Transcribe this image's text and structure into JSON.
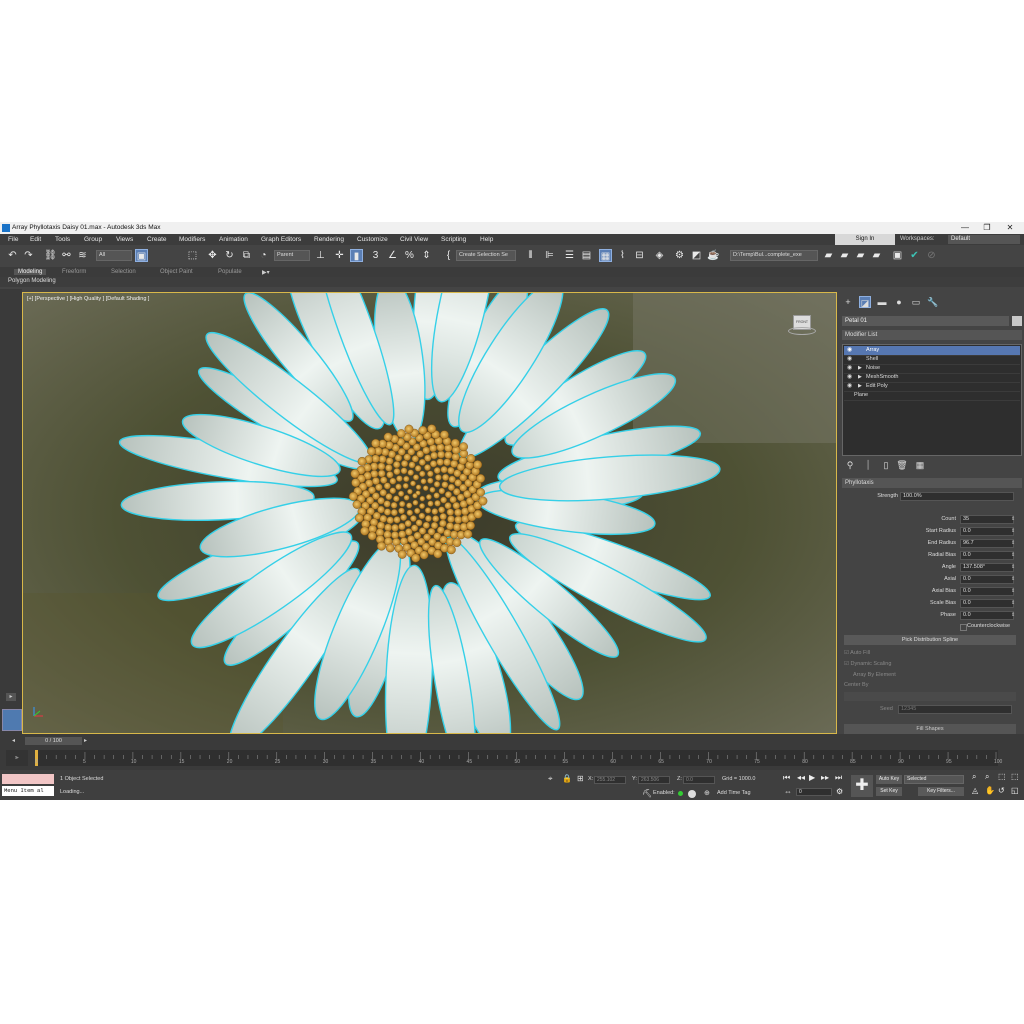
{
  "window": {
    "title": "Array Phyllotaxis Daisy 01.max - Autodesk 3ds Max",
    "minimize": "—",
    "maximize": "❐",
    "close": "✕"
  },
  "menu": [
    "File",
    "Edit",
    "Tools",
    "Group",
    "Views",
    "Create",
    "Modifiers",
    "Animation",
    "Graph Editors",
    "Rendering",
    "Customize",
    "Civil View",
    "Scripting",
    "Help"
  ],
  "account": {
    "sign_in": "Sign In",
    "workspaces_label": "Workspaces:",
    "workspace": "Default"
  },
  "toolbar": {
    "filter": "All",
    "coord_system": "Parent",
    "selection_set": "Create Selection Se",
    "project_path": "D:\\Temp\\Bul...complete_exe"
  },
  "ribbon": {
    "tabs": [
      "Modeling",
      "Freeform",
      "Selection",
      "Object Paint",
      "Populate"
    ],
    "panel": "Polygon Modeling"
  },
  "viewport": {
    "label": "[+] [Perspective ] [High Quality ] [Default Shading ]",
    "viewcube": "FRONT"
  },
  "command_panel": {
    "object_name": "Petal 01",
    "modifier_list": "Modifier List",
    "stack": [
      {
        "name": "Array",
        "selected": true
      },
      {
        "name": "Shell"
      },
      {
        "name": "Noise"
      },
      {
        "name": "MeshSmooth"
      },
      {
        "name": "Edit Poly"
      },
      {
        "name": "Plane"
      }
    ],
    "rollout": "Phyllotaxis",
    "strength_label": "Strength",
    "strength": "100.0%",
    "params": [
      {
        "label": "Count",
        "value": "35"
      },
      {
        "label": "Start Radius",
        "value": "0.0"
      },
      {
        "label": "End Radius",
        "value": "96.7"
      },
      {
        "label": "Radial Bias",
        "value": "0.0"
      },
      {
        "label": "Angle",
        "value": "137.508°"
      },
      {
        "label": "Axial",
        "value": "0.0"
      },
      {
        "label": "Axial Bias",
        "value": "0.0"
      },
      {
        "label": "Scale Bias",
        "value": "0.0"
      },
      {
        "label": "Phase",
        "value": "0.0"
      }
    ],
    "counterclockwise": "Counterclockwise",
    "pick_spline": "Pick Distribution Spline",
    "auto_fill": "Auto Fill",
    "dynamic_scaling": "Dynamic Scaling",
    "array_by_element": "Array By Element",
    "center_by": "Center By",
    "seed_label": "Seed",
    "seed": "12345",
    "next_rollout": "Fill Shapes"
  },
  "timeline": {
    "frame": "0 / 100",
    "ticks": [
      "0",
      "5",
      "10",
      "15",
      "20",
      "25",
      "30",
      "35",
      "40",
      "45",
      "50",
      "55",
      "60",
      "65",
      "70",
      "75",
      "80",
      "85",
      "90",
      "95",
      "100"
    ]
  },
  "status": {
    "selected": "1 Object Selected",
    "loading": "Loading...",
    "menu_item": "Menu Item al",
    "x_label": "X:",
    "x": "255.102",
    "y_label": "Y:",
    "y": "263.506",
    "z_label": "Z:",
    "z": "0.0",
    "grid": "Grid = 1000.0",
    "enabled": "Enabled:",
    "add_time_tag": "Add Time Tag",
    "auto_key": "Auto Key",
    "set_key": "Set Key",
    "key_mode": "Selected",
    "key_filters": "Key Filters...",
    "current_frame": "0"
  }
}
